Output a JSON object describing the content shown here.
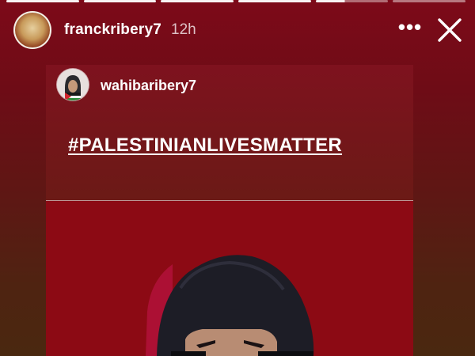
{
  "story": {
    "segments_total": 6,
    "segments_completed": 4,
    "active_segment_progress": 0.4,
    "author": {
      "username": "franckribery7",
      "time_ago": "12h"
    },
    "actions": {
      "more_icon": "more-horizontal-icon",
      "close_icon": "close-icon"
    }
  },
  "shared_post": {
    "author": {
      "username": "wahibaribery7"
    },
    "hashtag": "#PALESTINIANLIVESMATTER"
  },
  "colors": {
    "background_top": "#7d0a19",
    "background_bottom": "#4a2810",
    "image_background": "#8c0a14"
  }
}
